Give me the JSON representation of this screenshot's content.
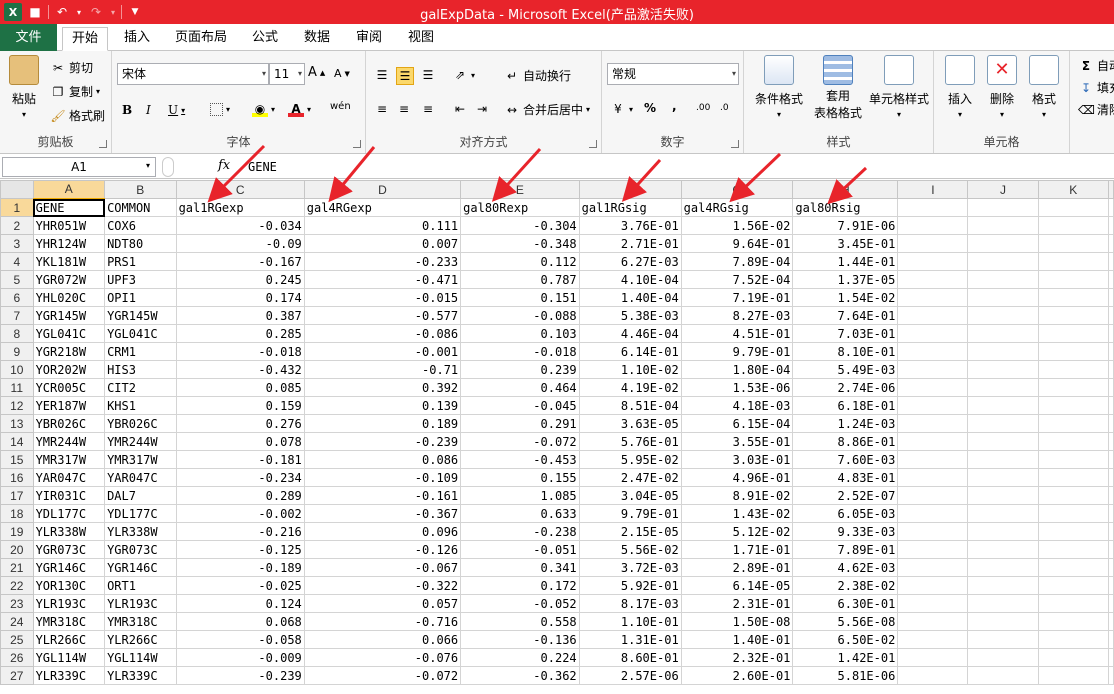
{
  "window": {
    "title": "galExpData - Microsoft Excel(产品激活失败)"
  },
  "quick_access": [
    "save-icon",
    "undo-icon",
    "redo-icon",
    "customize-icon"
  ],
  "tabs": [
    {
      "label": "文件"
    },
    {
      "label": "开始"
    },
    {
      "label": "插入"
    },
    {
      "label": "页面布局"
    },
    {
      "label": "公式"
    },
    {
      "label": "数据"
    },
    {
      "label": "审阅"
    },
    {
      "label": "视图"
    }
  ],
  "ribbon": {
    "clipboard": {
      "paste": "粘贴",
      "cut": "剪切",
      "copy": "复制",
      "format_painter": "格式刷",
      "label": "剪贴板"
    },
    "font": {
      "name": "宋体",
      "size": "11",
      "label": "字体",
      "bold": "B",
      "italic": "I",
      "underline": "U",
      "grow": "A",
      "shrink": "A",
      "wen": "wén"
    },
    "alignment": {
      "wrap": "自动换行",
      "merge": "合并后居中",
      "label": "对齐方式"
    },
    "number": {
      "format": "常规",
      "percent": "%",
      "comma": ",",
      "inc_decimal": ".00",
      "dec_decimal": ".0",
      "label": "数字"
    },
    "styles": {
      "conditional": "条件格式",
      "table_line1": "套用",
      "table_line2": "表格格式",
      "cell_styles": "单元格样式",
      "label": "样式"
    },
    "cells": {
      "insert": "插入",
      "delete": "删除",
      "format": "格式",
      "label": "单元格"
    },
    "editing": {
      "sum": "自动",
      "fill": "填充",
      "clear": "清除"
    }
  },
  "formula_bar": {
    "name_box": "A1",
    "fx": "fx",
    "formula": "GENE"
  },
  "columns": [
    "A",
    "B",
    "C",
    "D",
    "E",
    "F",
    "G",
    "H",
    "I",
    "J",
    "K"
  ],
  "header_row": [
    "GENE",
    "COMMON",
    "gal1RGexp",
    "gal4RGexp",
    "gal80Rexp",
    "gal1RGsig",
    "gal4RGsig",
    "gal80Rsig"
  ],
  "rows": [
    [
      "YHR051W",
      "COX6",
      "-0.034",
      "0.111",
      "-0.304",
      "3.76E-01",
      "1.56E-02",
      "7.91E-06"
    ],
    [
      "YHR124W",
      "NDT80",
      "-0.09",
      "0.007",
      "-0.348",
      "2.71E-01",
      "9.64E-01",
      "3.45E-01"
    ],
    [
      "YKL181W",
      "PRS1",
      "-0.167",
      "-0.233",
      "0.112",
      "6.27E-03",
      "7.89E-04",
      "1.44E-01"
    ],
    [
      "YGR072W",
      "UPF3",
      "0.245",
      "-0.471",
      "0.787",
      "4.10E-04",
      "7.52E-04",
      "1.37E-05"
    ],
    [
      "YHL020C",
      "OPI1",
      "0.174",
      "-0.015",
      "0.151",
      "1.40E-04",
      "7.19E-01",
      "1.54E-02"
    ],
    [
      "YGR145W",
      "YGR145W",
      "0.387",
      "-0.577",
      "-0.088",
      "5.38E-03",
      "8.27E-03",
      "7.64E-01"
    ],
    [
      "YGL041C",
      "YGL041C",
      "0.285",
      "-0.086",
      "0.103",
      "4.46E-04",
      "4.51E-01",
      "7.03E-01"
    ],
    [
      "YGR218W",
      "CRM1",
      "-0.018",
      "-0.001",
      "-0.018",
      "6.14E-01",
      "9.79E-01",
      "8.10E-01"
    ],
    [
      "YOR202W",
      "HIS3",
      "-0.432",
      "-0.71",
      "0.239",
      "1.10E-02",
      "1.80E-04",
      "5.49E-03"
    ],
    [
      "YCR005C",
      "CIT2",
      "0.085",
      "0.392",
      "0.464",
      "4.19E-02",
      "1.53E-06",
      "2.74E-06"
    ],
    [
      "YER187W",
      "KHS1",
      "0.159",
      "0.139",
      "-0.045",
      "8.51E-04",
      "4.18E-03",
      "6.18E-01"
    ],
    [
      "YBR026C",
      "YBR026C",
      "0.276",
      "0.189",
      "0.291",
      "3.63E-05",
      "6.15E-04",
      "1.24E-03"
    ],
    [
      "YMR244W",
      "YMR244W",
      "0.078",
      "-0.239",
      "-0.072",
      "5.76E-01",
      "3.55E-01",
      "8.86E-01"
    ],
    [
      "YMR317W",
      "YMR317W",
      "-0.181",
      "0.086",
      "-0.453",
      "5.95E-02",
      "3.03E-01",
      "7.60E-03"
    ],
    [
      "YAR047C",
      "YAR047C",
      "-0.234",
      "-0.109",
      "0.155",
      "2.47E-02",
      "4.96E-01",
      "4.83E-01"
    ],
    [
      "YIR031C",
      "DAL7",
      "0.289",
      "-0.161",
      "1.085",
      "3.04E-05",
      "8.91E-02",
      "2.52E-07"
    ],
    [
      "YDL177C",
      "YDL177C",
      "-0.002",
      "-0.367",
      "0.633",
      "9.79E-01",
      "1.43E-02",
      "6.05E-03"
    ],
    [
      "YLR338W",
      "YLR338W",
      "-0.216",
      "0.096",
      "-0.238",
      "2.15E-05",
      "5.12E-02",
      "9.33E-03"
    ],
    [
      "YGR073C",
      "YGR073C",
      "-0.125",
      "-0.126",
      "-0.051",
      "5.56E-02",
      "1.71E-01",
      "7.89E-01"
    ],
    [
      "YGR146C",
      "YGR146C",
      "-0.189",
      "-0.067",
      "0.341",
      "3.72E-03",
      "2.89E-01",
      "4.62E-03"
    ],
    [
      "YOR130C",
      "ORT1",
      "-0.025",
      "-0.322",
      "0.172",
      "5.92E-01",
      "6.14E-05",
      "2.38E-02"
    ],
    [
      "YLR193C",
      "YLR193C",
      "0.124",
      "0.057",
      "-0.052",
      "8.17E-03",
      "2.31E-01",
      "6.30E-01"
    ],
    [
      "YMR318C",
      "YMR318C",
      "0.068",
      "-0.716",
      "0.558",
      "1.10E-01",
      "1.50E-08",
      "5.56E-08"
    ],
    [
      "YLR266C",
      "YLR266C",
      "-0.058",
      "0.066",
      "-0.136",
      "1.31E-01",
      "1.40E-01",
      "6.50E-02"
    ],
    [
      "YGL114W",
      "YGL114W",
      "-0.009",
      "-0.076",
      "0.224",
      "8.60E-01",
      "2.32E-01",
      "1.42E-01"
    ],
    [
      "YLR339C",
      "YLR339C",
      "-0.239",
      "-0.072",
      "-0.362",
      "2.57E-06",
      "2.60E-01",
      "5.81E-06"
    ]
  ],
  "colors": {
    "title_bar": "#e8242b",
    "file_tab": "#1e7145",
    "annotation_arrow": "#e8242b",
    "selection_header": "#f9d99a"
  }
}
